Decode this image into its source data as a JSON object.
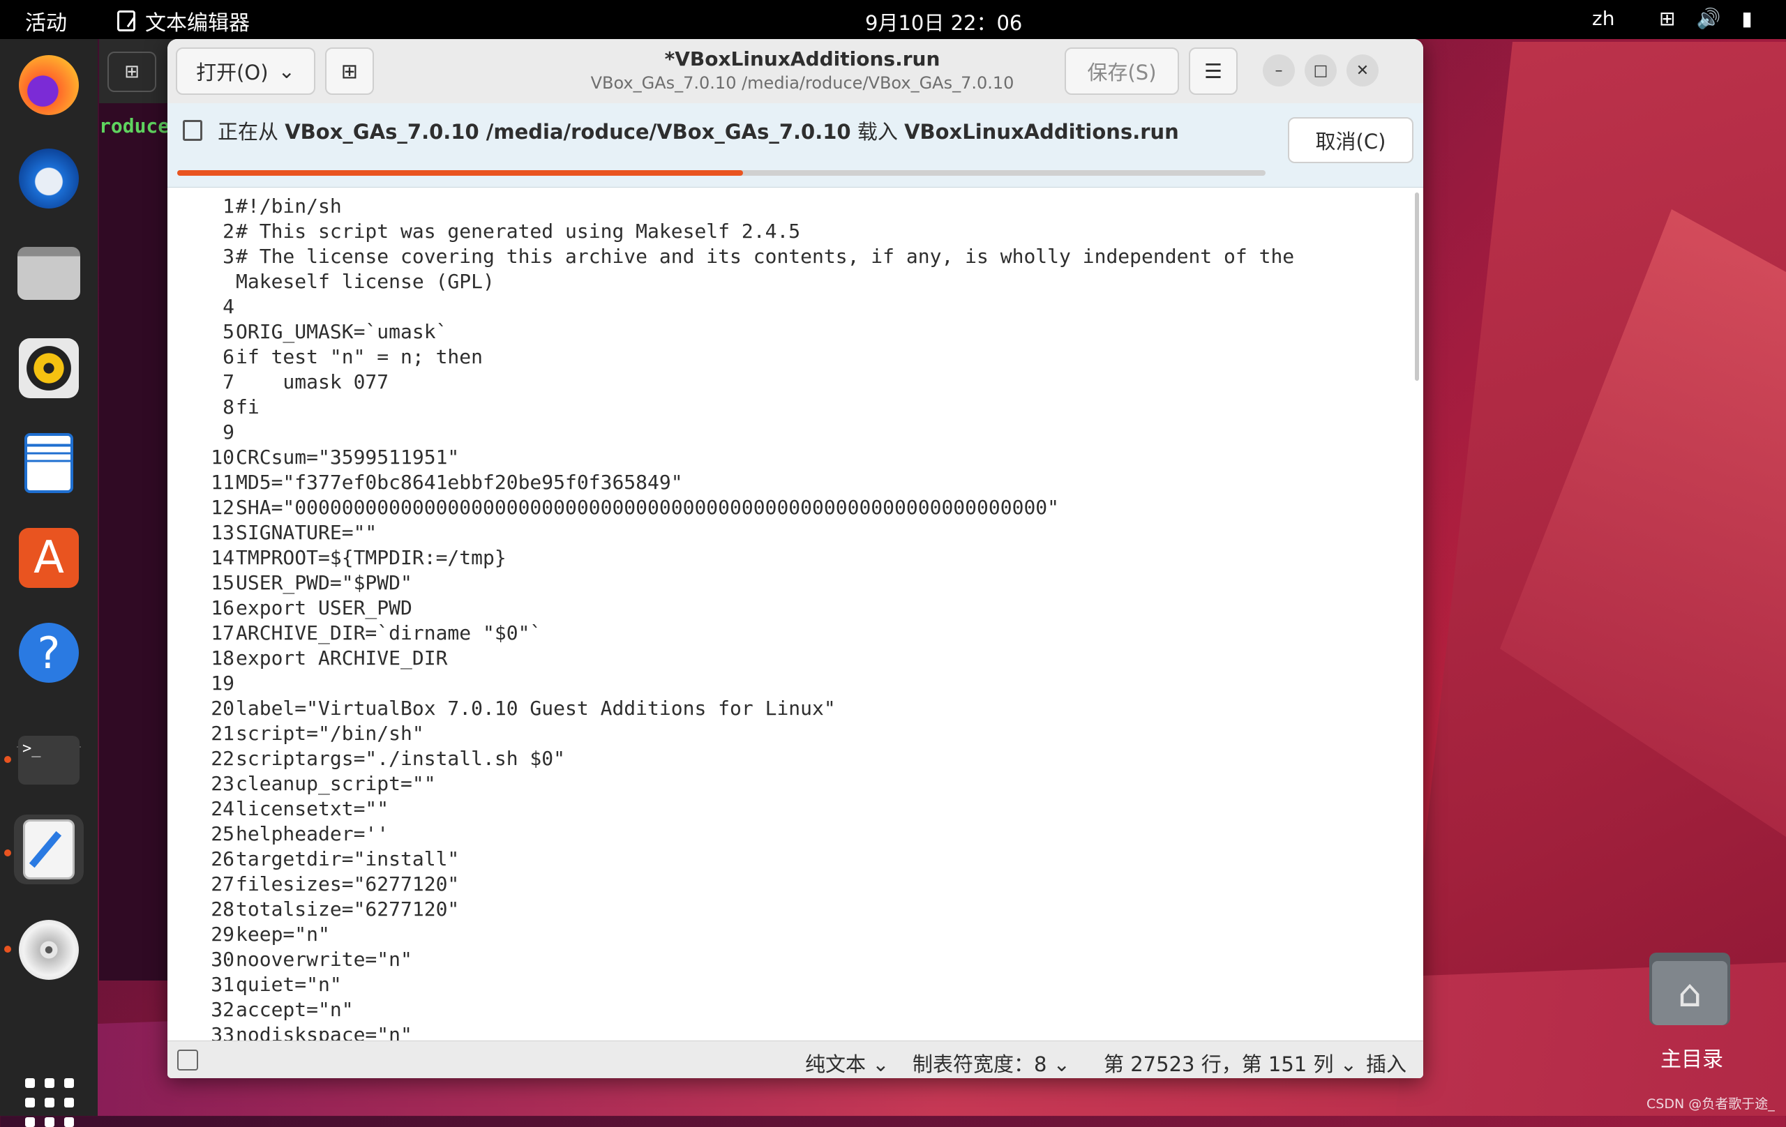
{
  "topbar": {
    "activities": "活动",
    "app_name": "文本编辑器",
    "clock": "9月10日  22：06",
    "lang": "zh"
  },
  "terminal": {
    "visible_text": "roduce"
  },
  "window": {
    "open_label": "打开(O)",
    "title": "*VBoxLinuxAdditions.run",
    "subtitle": "VBox_GAs_7.0.10 /media/roduce/VBox_GAs_7.0.10",
    "save_label": "保存(S)"
  },
  "infobar": {
    "prefix": "正在从",
    "source": "VBox_GAs_7.0.10 /media/roduce/VBox_GAs_7.0.10",
    "middle": "载入",
    "file": "VBoxLinuxAdditions.run",
    "cancel_label": "取消(C)",
    "progress_percent": 52
  },
  "editor": {
    "lines": [
      {
        "n": "1",
        "t": "#!/bin/sh"
      },
      {
        "n": "2",
        "t": "# This script was generated using Makeself 2.4.5"
      },
      {
        "n": "3",
        "t": "# The license covering this archive and its contents, if any, is wholly independent of the"
      },
      {
        "n": "",
        "t": "Makeself license (GPL)"
      },
      {
        "n": "4",
        "t": ""
      },
      {
        "n": "5",
        "t": "ORIG_UMASK=`umask`"
      },
      {
        "n": "6",
        "t": "if test \"n\" = n; then"
      },
      {
        "n": "7",
        "t": "    umask 077"
      },
      {
        "n": "8",
        "t": "fi"
      },
      {
        "n": "9",
        "t": ""
      },
      {
        "n": "10",
        "t": "CRCsum=\"3599511951\""
      },
      {
        "n": "11",
        "t": "MD5=\"f377ef0bc8641ebbf20be95f0f365849\""
      },
      {
        "n": "12",
        "t": "SHA=\"0000000000000000000000000000000000000000000000000000000000000000\""
      },
      {
        "n": "13",
        "t": "SIGNATURE=\"\""
      },
      {
        "n": "14",
        "t": "TMPROOT=${TMPDIR:=/tmp}"
      },
      {
        "n": "15",
        "t": "USER_PWD=\"$PWD\""
      },
      {
        "n": "16",
        "t": "export USER_PWD"
      },
      {
        "n": "17",
        "t": "ARCHIVE_DIR=`dirname \"$0\"`"
      },
      {
        "n": "18",
        "t": "export ARCHIVE_DIR"
      },
      {
        "n": "19",
        "t": ""
      },
      {
        "n": "20",
        "t": "label=\"VirtualBox 7.0.10 Guest Additions for Linux\""
      },
      {
        "n": "21",
        "t": "script=\"/bin/sh\""
      },
      {
        "n": "22",
        "t": "scriptargs=\"./install.sh $0\""
      },
      {
        "n": "23",
        "t": "cleanup_script=\"\""
      },
      {
        "n": "24",
        "t": "licensetxt=\"\""
      },
      {
        "n": "25",
        "t": "helpheader=''"
      },
      {
        "n": "26",
        "t": "targetdir=\"install\""
      },
      {
        "n": "27",
        "t": "filesizes=\"6277120\""
      },
      {
        "n": "28",
        "t": "totalsize=\"6277120\""
      },
      {
        "n": "29",
        "t": "keep=\"n\""
      },
      {
        "n": "30",
        "t": "nooverwrite=\"n\""
      },
      {
        "n": "31",
        "t": "quiet=\"n\""
      },
      {
        "n": "32",
        "t": "accept=\"n\""
      },
      {
        "n": "33",
        "t": "nodiskspace=\"n\""
      }
    ]
  },
  "statusbar": {
    "language": "纯文本",
    "tab_width": "制表符宽度：8",
    "position": "第 27523 行，第 151 列",
    "mode": "插入"
  },
  "desktop": {
    "home_label": "主目录"
  },
  "watermark": "CSDN @负者歌于途_",
  "colors": {
    "accent": "#e95420",
    "terminal_bg": "#300a24"
  }
}
